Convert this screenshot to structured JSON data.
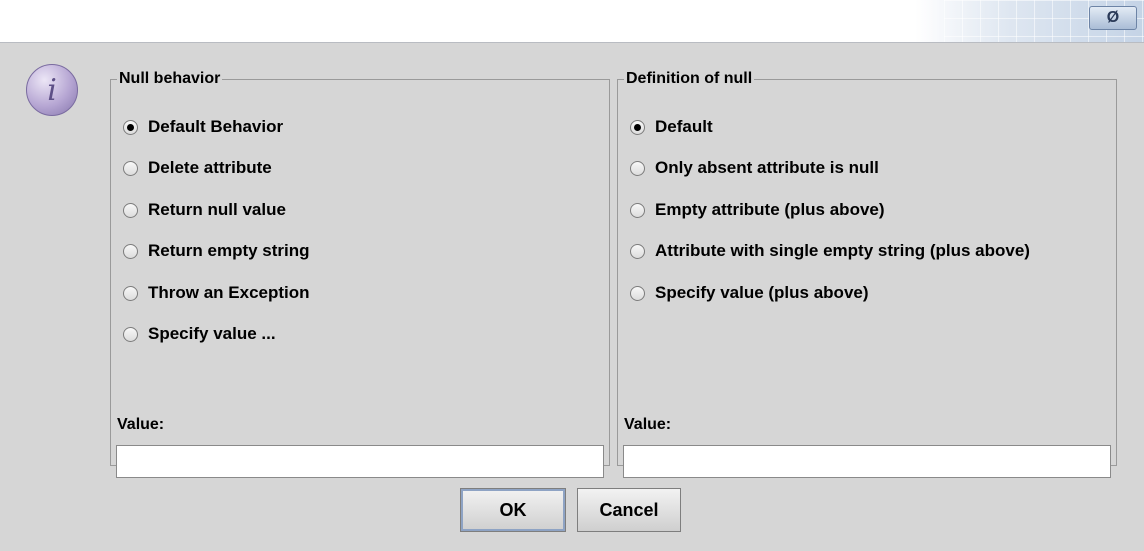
{
  "titlebar": {
    "button_glyph": "Ø"
  },
  "icon": {
    "name": "info-icon",
    "glyph": "i"
  },
  "null_behavior": {
    "legend": "Null behavior",
    "options": [
      {
        "label": "Default Behavior",
        "selected": true
      },
      {
        "label": "Delete attribute",
        "selected": false
      },
      {
        "label": "Return null value",
        "selected": false
      },
      {
        "label": "Return empty string",
        "selected": false
      },
      {
        "label": "Throw an Exception",
        "selected": false
      },
      {
        "label": "Specify value ...",
        "selected": false
      }
    ],
    "value_label": "Value:",
    "value": ""
  },
  "null_definition": {
    "legend": "Definition of null",
    "options": [
      {
        "label": "Default",
        "selected": true
      },
      {
        "label": "Only absent attribute is null",
        "selected": false
      },
      {
        "label": "Empty attribute (plus above)",
        "selected": false
      },
      {
        "label": "Attribute with single empty string (plus above)",
        "selected": false
      },
      {
        "label": "Specify value (plus above)",
        "selected": false
      }
    ],
    "value_label": "Value:",
    "value": ""
  },
  "buttons": {
    "ok": "OK",
    "cancel": "Cancel"
  }
}
